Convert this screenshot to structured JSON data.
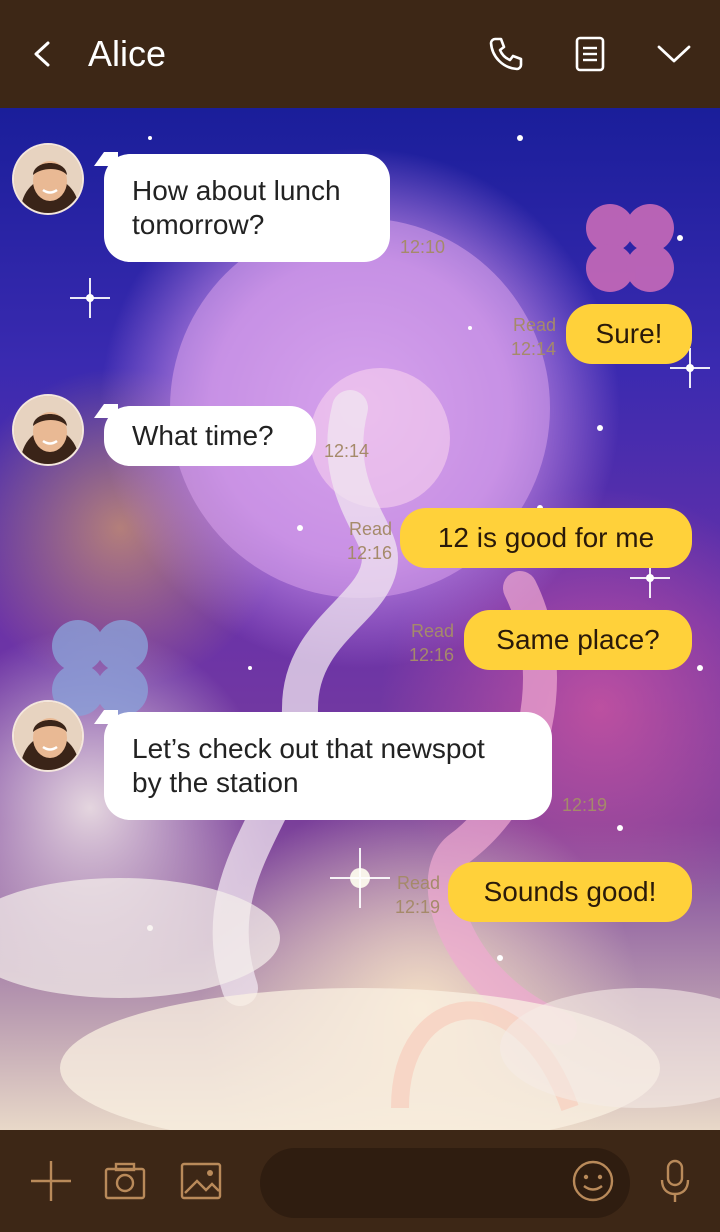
{
  "header": {
    "title": "Alice",
    "back_icon": "chevron-left-icon",
    "call_icon": "phone-icon",
    "notes_icon": "notes-icon",
    "more_icon": "chevron-down-icon"
  },
  "colors": {
    "header_bg": "#3d2716",
    "bubble_out": "#ffd13a",
    "bubble_in": "#ffffff",
    "meta_text": "#a58a6a",
    "footer_icon": "#b98a5a"
  },
  "messages": [
    {
      "direction": "in",
      "lines": [
        "How about lunch",
        "tomorrow?"
      ],
      "time": "12:10"
    },
    {
      "direction": "out",
      "text": "Sure!",
      "read": "Read",
      "time": "12:14"
    },
    {
      "direction": "in",
      "lines": [
        "What time?"
      ],
      "time": "12:14"
    },
    {
      "direction": "out",
      "text": "12 is good for me",
      "read": "Read",
      "time": "12:16"
    },
    {
      "direction": "out",
      "text": "Same place?",
      "read": "Read",
      "time": "12:16"
    },
    {
      "direction": "in",
      "lines": [
        "Let’s check out that newspot",
        "by the station"
      ],
      "time": "12:19"
    },
    {
      "direction": "out",
      "text": "Sounds good!",
      "read": "Read",
      "time": "12:19"
    }
  ],
  "footer": {
    "plus_icon": "plus-icon",
    "camera_icon": "camera-icon",
    "image_icon": "image-icon",
    "emoji_icon": "smiley-icon",
    "mic_icon": "microphone-icon",
    "input_placeholder": ""
  }
}
